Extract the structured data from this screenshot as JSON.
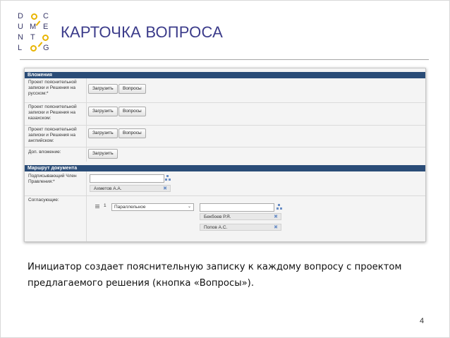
{
  "logo": {
    "letters": [
      "D",
      "O",
      "C",
      "U",
      "M",
      "E",
      "N",
      "T",
      "O",
      "L",
      "O",
      "G"
    ]
  },
  "title": "КАРТОЧКА ВОПРОСА",
  "form": {
    "attachments_header": "Вложения",
    "rows": [
      {
        "label": "Проект пояснительной записки и Решения на русском:*",
        "buttons": [
          "Загрузить",
          "Вопросы"
        ]
      },
      {
        "label": "Проект пояснительной записки и Решения на казахском:",
        "buttons": [
          "Загрузить",
          "Вопросы"
        ]
      },
      {
        "label": "Проект пояснительной записки и Решения на английском:",
        "buttons": [
          "Загрузить",
          "Вопросы"
        ]
      },
      {
        "label": "Доп. вложение:",
        "buttons": [
          "Загрузить"
        ]
      }
    ],
    "route_header": "Маршрут документа",
    "signer": {
      "label": "Подписывающий Член Правления:*",
      "value": "Ахметов А.А."
    },
    "approvers": {
      "label": "Согласующие:",
      "step_number": "1",
      "mode": "Параллельное",
      "people": [
        "Бекбоев Р.Я.",
        "Попов А.С."
      ]
    }
  },
  "body_text_line1": "Инициатор создает пояснительную записку к каждому вопросу с проектом",
  "body_text_line2": "предлагаемого решения (кнопка «Вопросы»).",
  "page_number": "4",
  "colors": {
    "title": "#3b3b8a",
    "header_bar": "#2a4c77",
    "logo_accent": "#e8b400"
  }
}
